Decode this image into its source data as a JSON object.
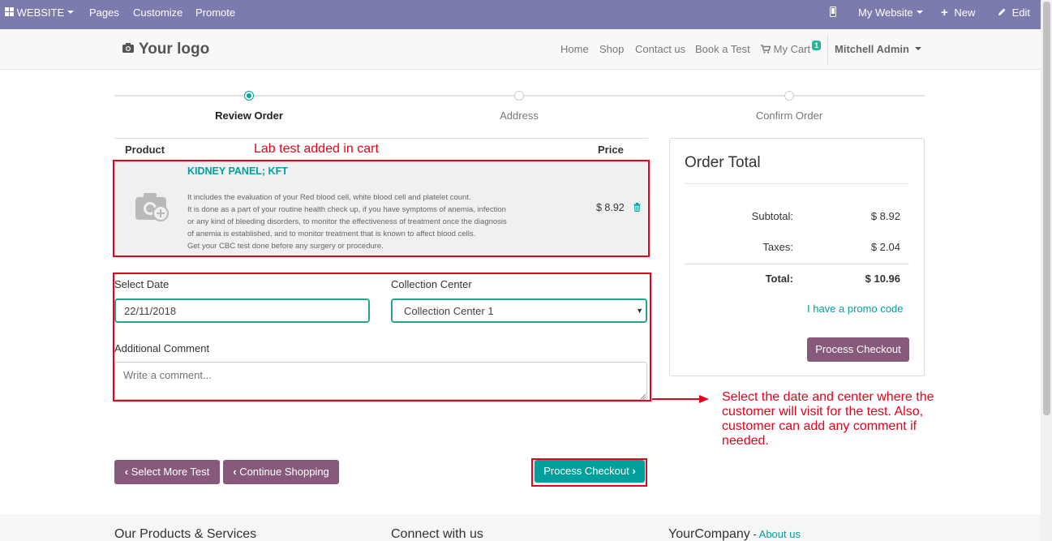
{
  "adminbar": {
    "website_label": "WEBSITE",
    "pages": "Pages",
    "customize": "Customize",
    "promote": "Promote",
    "my_website": "My Website",
    "new": "New",
    "edit": "Edit"
  },
  "header": {
    "logo": "Your logo",
    "nav": [
      "Home",
      "Shop",
      "Contact us",
      "Book a Test"
    ],
    "cart_label": "My Cart",
    "cart_count": "1",
    "user": "Mitchell Admin"
  },
  "wizard": {
    "steps": [
      "Review Order",
      "Address",
      "Confirm Order"
    ],
    "active_step": "Review Order"
  },
  "cart": {
    "col_product": "Product",
    "col_price": "Price",
    "annotation": "Lab test added in cart",
    "item": {
      "name": "KIDNEY PANEL; KFT",
      "description": [
        "It includes the evaluation of your Red blood cell, white blood cell and platelet count.",
        "It is done as a part of your routine health check up, if you have symptoms of anemia, infection",
        "or any kind of bleeding disorders, to monitor the effectiveness of treatment once the diagnosis",
        "of anemia is established, and to monitor treatment that is known to affect blood cells.",
        "Get your CBC test done before any surgery or procedure."
      ],
      "price": "$ 8.92"
    }
  },
  "form": {
    "date_label": "Select Date",
    "date_value": "22/11/2018",
    "center_label": "Collection Center",
    "center_value": "Collection Center 1",
    "comment_label": "Additional Comment",
    "comment_placeholder": "Write a comment..."
  },
  "note": "Select the date and center where the customer will visit for the test. Also, customer can add any comment if needed.",
  "buttons": {
    "select_more": "Select More Test",
    "continue": "Continue Shopping",
    "process": "Process Checkout"
  },
  "order_total": {
    "title": "Order Total",
    "subtotal_label": "Subtotal:",
    "subtotal": "$ 8.92",
    "taxes_label": "Taxes:",
    "taxes": "$ 2.04",
    "total_label": "Total:",
    "total": "$ 10.96",
    "promo": "I have a promo code",
    "button": "Process Checkout"
  },
  "footer": {
    "col1": "Our Products & Services",
    "col2": "Connect with us",
    "col3": "YourCompany",
    "col3_sep": " - ",
    "col3_link": "About us"
  },
  "colors": {
    "admin_bar": "#7c7bad",
    "accent_teal": "#00a09d",
    "purple_button": "#875a7b",
    "annotation_red": "#e8001a"
  }
}
